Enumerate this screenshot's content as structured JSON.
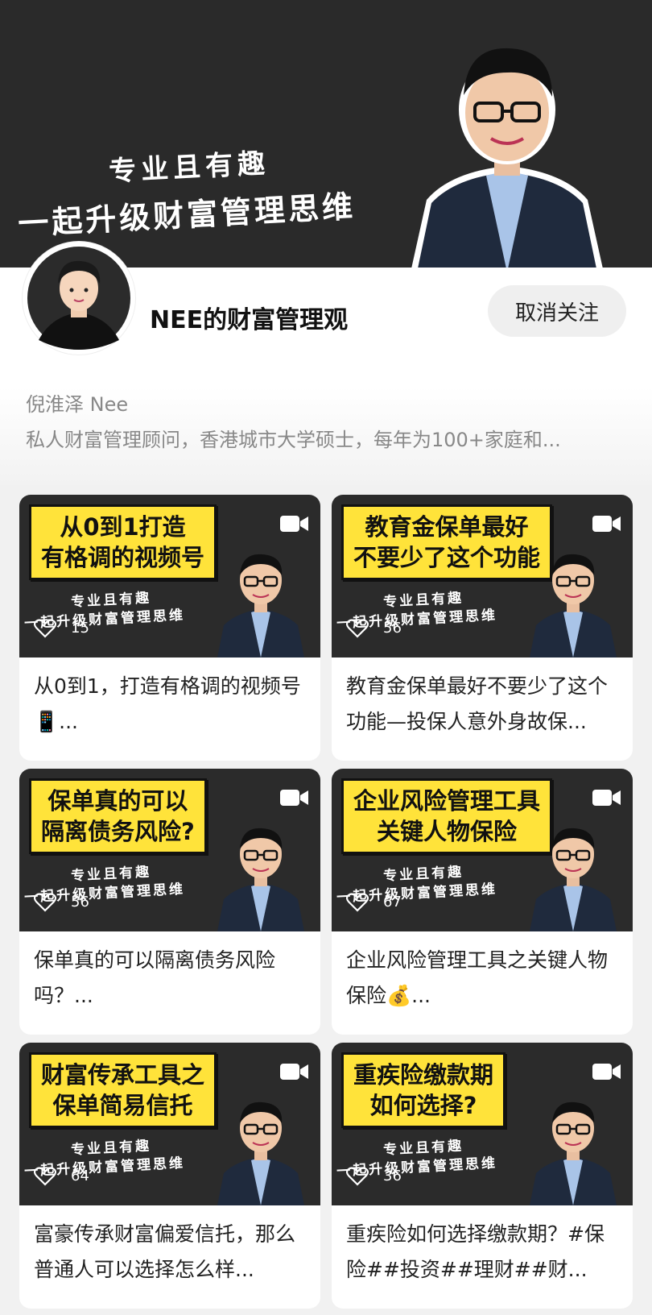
{
  "banner": {
    "line1": "专业且有趣",
    "line2": "一起升级财富管理思维"
  },
  "profile": {
    "account_name": "NEE的财富管理观",
    "unfollow_label": "取消关注",
    "real_name": "倪淮泽 Nee",
    "bio": "私人财富管理顾问，香港城市大学硕士，每年为100+家庭和..."
  },
  "thumb_subtitle": {
    "line1": "专业且有趣",
    "line2": "一起升级财富管理思维"
  },
  "videos": [
    {
      "thumb_line1": "从0到1打造",
      "thumb_line2": "有格调的视频号",
      "likes": "15",
      "title": "从0到1，打造有格调的视频号📱..."
    },
    {
      "thumb_line1": "教育金保单最好",
      "thumb_line2": "不要少了这个功能",
      "likes": "56",
      "title": "教育金保单最好不要少了这个功能—投保人意外身故保..."
    },
    {
      "thumb_line1": "保单真的可以",
      "thumb_line2": "隔离债务风险?",
      "likes": "56",
      "title": "保单真的可以隔离债务风险吗？..."
    },
    {
      "thumb_line1": "企业风险管理工具",
      "thumb_line2": "关键人物保险",
      "likes": "67",
      "title": "企业风险管理工具之关键人物保险💰..."
    },
    {
      "thumb_line1": "财富传承工具之",
      "thumb_line2": "保单简易信托",
      "likes": "64",
      "title": "富豪传承财富偏爱信托，那么普通人可以选择怎么样..."
    },
    {
      "thumb_line1": "重疾险缴款期",
      "thumb_line2": "如何选择?",
      "likes": "36",
      "title": "重疾险如何选择缴款期？#保险##投资##理财##财..."
    }
  ]
}
